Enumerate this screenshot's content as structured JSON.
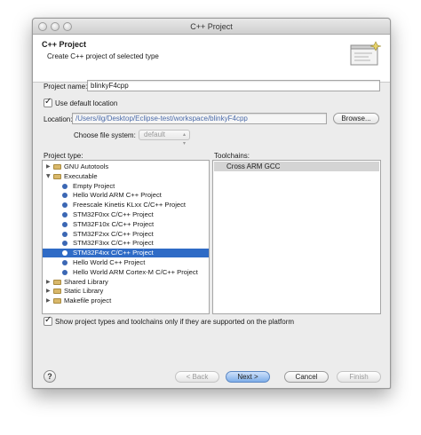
{
  "window": {
    "title": "C++ Project"
  },
  "banner": {
    "title": "C++ Project",
    "description": "Create C++ project of selected type"
  },
  "form": {
    "project_name_label": "Project name:",
    "project_name_value": "blinkyF4cpp",
    "use_default_location_label": "Use default location",
    "use_default_location_checked": true,
    "location_label": "Location:",
    "location_value": "/Users/ilg/Desktop/Eclipse-test/workspace/blinkyF4cpp",
    "browse_label": "Browse...",
    "filesystem_label": "Choose file system:",
    "filesystem_value": "default"
  },
  "project_type": {
    "label": "Project type:",
    "items": [
      {
        "label": "GNU Autotools",
        "kind": "folder",
        "expanded": false,
        "level": 0
      },
      {
        "label": "Executable",
        "kind": "folder",
        "expanded": true,
        "level": 0
      },
      {
        "label": "Empty Project",
        "kind": "item",
        "level": 1
      },
      {
        "label": "Hello World ARM C++ Project",
        "kind": "item",
        "level": 1
      },
      {
        "label": "Freescale Kinetis KLxx C/C++ Project",
        "kind": "item",
        "level": 1
      },
      {
        "label": "STM32F0xx C/C++ Project",
        "kind": "item",
        "level": 1
      },
      {
        "label": "STM32F10x C/C++ Project",
        "kind": "item",
        "level": 1
      },
      {
        "label": "STM32F2xx C/C++ Project",
        "kind": "item",
        "level": 1
      },
      {
        "label": "STM32F3xx C/C++ Project",
        "kind": "item",
        "level": 1
      },
      {
        "label": "STM32F4xx C/C++ Project",
        "kind": "item",
        "level": 1,
        "selected": true
      },
      {
        "label": "Hello World C++ Project",
        "kind": "item",
        "level": 1
      },
      {
        "label": "Hello World ARM Cortex-M C/C++ Project",
        "kind": "item",
        "level": 1
      },
      {
        "label": "Shared Library",
        "kind": "folder",
        "expanded": false,
        "level": 0
      },
      {
        "label": "Static Library",
        "kind": "folder",
        "expanded": false,
        "level": 0
      },
      {
        "label": "Makefile project",
        "kind": "folder",
        "expanded": false,
        "level": 0
      }
    ]
  },
  "toolchains": {
    "label": "Toolchains:",
    "items": [
      {
        "label": "Cross ARM GCC",
        "selected": true
      }
    ]
  },
  "filter": {
    "label": "Show project types and toolchains only if they are supported on the platform",
    "checked": true
  },
  "buttons": {
    "help": "?",
    "back": "< Back",
    "next": "Next >",
    "cancel": "Cancel",
    "finish": "Finish"
  },
  "colors": {
    "selection": "#2f6bc6",
    "default_button": "#7eaee9",
    "path_text": "#4a6aa8"
  },
  "icons": [
    "help-icon",
    "folder-icon",
    "project-bullet-icon",
    "wizard-banner-icon",
    "checkmark-icon"
  ]
}
